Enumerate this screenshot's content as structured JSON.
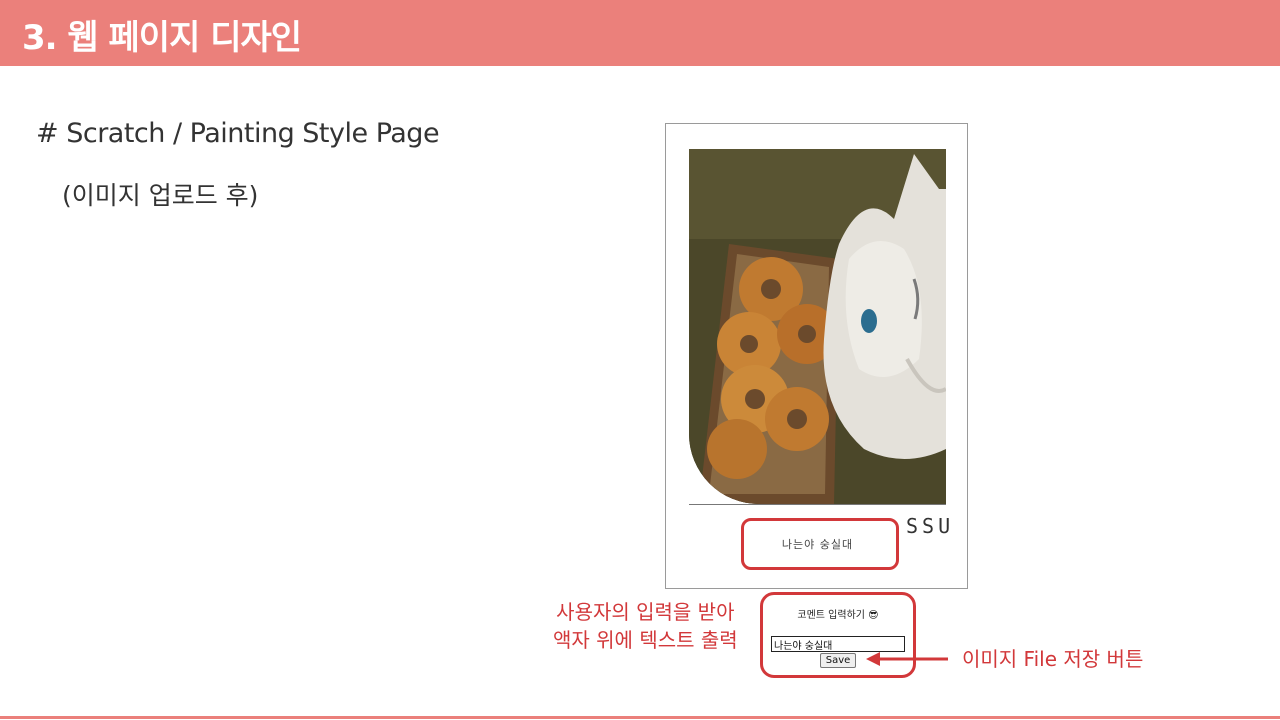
{
  "slide": {
    "title": "3. 웹 페이지 디자인",
    "heading": "# Scratch / Painting Style Page",
    "subheading": "(이미지 업로드 후)"
  },
  "frame": {
    "brand": "SSU",
    "caption": "나는야 숭실대"
  },
  "form": {
    "label": "코멘트 입력하기 😎",
    "input_value": "나는야 숭실대",
    "save_label": "Save"
  },
  "annotations": {
    "left_line1": "사용자의 입력을 받아",
    "left_line2": "액자 위에 텍스트 출력",
    "right": "이미지 File 저장 버튼"
  },
  "colors": {
    "accent": "#eb807b",
    "annotation_red": "#d2383a"
  }
}
